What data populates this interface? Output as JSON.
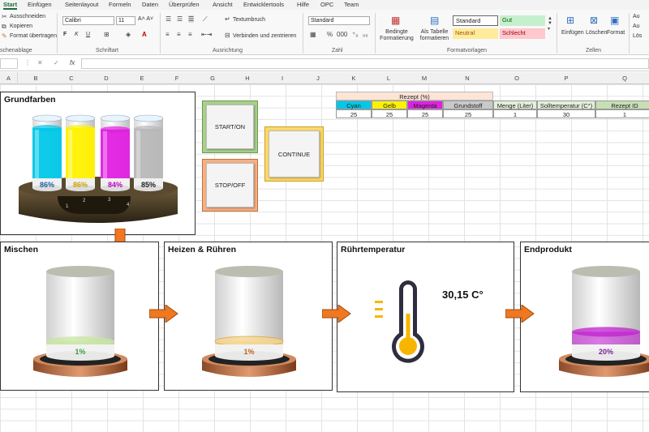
{
  "tabs": [
    "Start",
    "Einfügen",
    "Seitenlayout",
    "Formeln",
    "Daten",
    "Überprüfen",
    "Ansicht",
    "Entwicklertools",
    "Hilfe",
    "OPC",
    "Team"
  ],
  "clipboard": {
    "cut": "Ausschneiden",
    "copy": "Kopieren",
    "format": "Format übertragen",
    "title": "schenablage"
  },
  "font": {
    "name": "Calibri",
    "size": "11",
    "title": "Schriftart"
  },
  "alignment": {
    "wrap": "Textumbruch",
    "merge": "Verbinden und zentrieren",
    "title": "Ausrichtung"
  },
  "number": {
    "format": "Standard",
    "title": "Zahl"
  },
  "styles": {
    "cond": "Bedingte Formatierung",
    "table": "Als Tabelle formatieren",
    "standard": "Standard",
    "gut": "Gut",
    "neutral": "Neutral",
    "schlecht": "Schlecht",
    "title": "Formatvorlagen"
  },
  "cells": {
    "insert": "Einfügen",
    "delete": "Löschen",
    "format": "Format",
    "title": "Zellen",
    "extra1": "Au",
    "extra2": "Au",
    "extra3": "Lös"
  },
  "formula_bar": {
    "fx": "fx"
  },
  "columns": [
    "A",
    "B",
    "C",
    "D",
    "E",
    "F",
    "G",
    "H",
    "I",
    "J",
    "K",
    "L",
    "M",
    "N",
    "O",
    "P",
    "Q"
  ],
  "grundfarben": {
    "title": "Grundfarben",
    "cyan_pct": "86%",
    "yellow_pct": "86%",
    "magenta_pct": "84%",
    "gray_pct": "85%",
    "cyan_level": 0.86,
    "yellow_level": 0.86,
    "magenta_level": 0.84,
    "gray_level": 0.85,
    "slots": [
      "1",
      "2",
      "3",
      "4"
    ]
  },
  "buttons": {
    "start": "START/ON",
    "stop": "STOP/OFF",
    "continue": "CONTINUE"
  },
  "recipe": {
    "header": "Rezept (%)",
    "cols": [
      "Cyan",
      "Gelb",
      "Magenta",
      "Grundstoff",
      "Menge (Liter)",
      "Solltemperatur (C°)",
      "Rezept ID"
    ],
    "vals": [
      "25",
      "25",
      "25",
      "25",
      "1",
      "30",
      "1"
    ]
  },
  "mischen": {
    "title": "Mischen",
    "pct": "1%",
    "level": 0.01
  },
  "heizen": {
    "title": "Heizen & Rühren",
    "pct": "1%",
    "level": 0.01
  },
  "temp": {
    "title": "Rührtemperatur",
    "value": "30,15 C°"
  },
  "endprodukt": {
    "title": "Endprodukt",
    "pct": "20%",
    "level": 0.2
  },
  "colors": {
    "cyan": "#00c8e8",
    "yellow": "#fff200",
    "magenta": "#e020e0",
    "gray": "#b8b8b8",
    "orange": "#f07820",
    "green_btn": "#a8d08d",
    "orange_btn": "#f4b183",
    "yellow_btn": "#ffd966"
  }
}
